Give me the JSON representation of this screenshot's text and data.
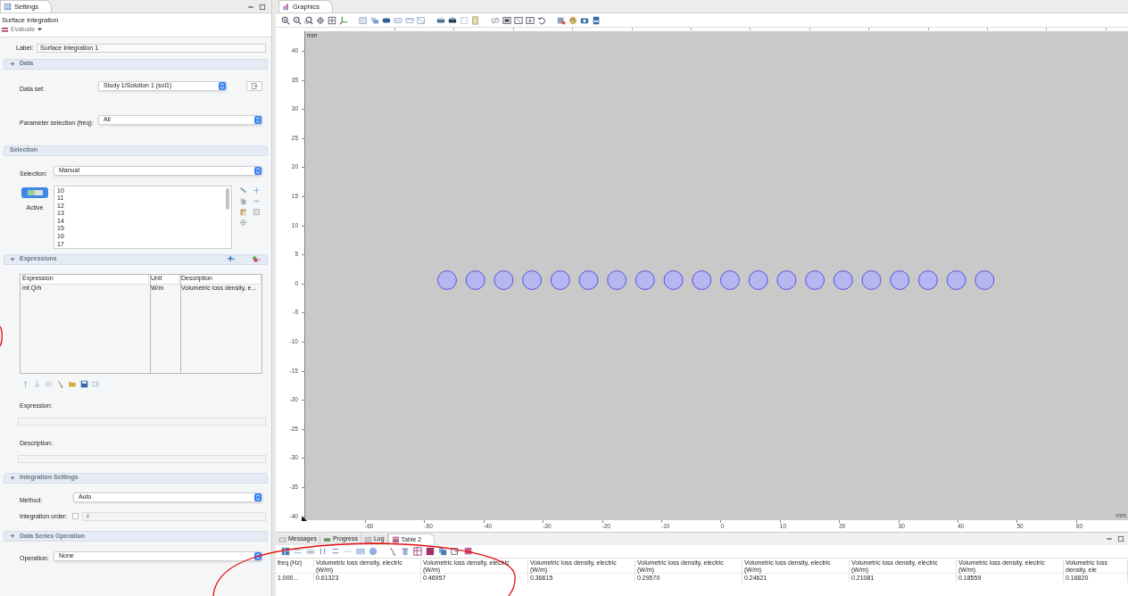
{
  "settings": {
    "tab": "Settings",
    "heading": "Surface Integration",
    "evaluate": "Evaluate",
    "label_caption": "Label:",
    "label_value": "Surface Integration 1"
  },
  "data_section": {
    "title": "Data",
    "expanded": true,
    "dataset_label": "Data set:",
    "dataset_value": "Study 1/Solution 1 (sol1)",
    "param_label": "Parameter selection (freq):",
    "param_value": "All"
  },
  "selection_section": {
    "title": "Selection",
    "selection_label": "Selection:",
    "selection_value": "Manual",
    "active": true,
    "active_label": "Active",
    "items": [
      "10",
      "11",
      "12",
      "13",
      "14",
      "15",
      "16",
      "17"
    ]
  },
  "expressions_section": {
    "title": "Expressions",
    "expanded": true,
    "columns": [
      "Expression",
      "Unit",
      "Description"
    ],
    "rows": [
      [
        "mf.Qrh",
        "W/m",
        "Volumetric loss density, e..."
      ]
    ],
    "expression_label": "Expression:",
    "description_label": "Description:"
  },
  "integration_section": {
    "title": "Integration Settings",
    "expanded": true,
    "method_label": "Method:",
    "method_value": "Auto",
    "order_label": "Integration order:",
    "order_checked": false,
    "order_value": "4"
  },
  "data_series_section": {
    "title": "Data Series Operation",
    "expanded": true,
    "operation_label": "Operation:",
    "operation_value": "None"
  },
  "graphics": {
    "tab": "Graphics",
    "unit": "mm",
    "unit_corner": "mm",
    "y_ticks": [
      "40",
      "35",
      "30",
      "25",
      "20",
      "15",
      "10",
      "5",
      "0",
      "-5",
      "-10",
      "-15",
      "-20",
      "-25",
      "-30",
      "-35",
      "-40"
    ],
    "x_ticks": [
      "-60",
      "-50",
      "-40",
      "-30",
      "-20",
      "-10",
      "0",
      "10",
      "20",
      "30",
      "40",
      "50",
      "60"
    ]
  },
  "bottom_tabs": [
    {
      "label": "Messages",
      "selected": false
    },
    {
      "label": "Progress",
      "selected": false
    },
    {
      "label": "Log",
      "selected": false
    },
    {
      "label": "Table 2",
      "selected": true
    }
  ],
  "table": {
    "columns": [
      "freq (Hz)",
      "Volumetric loss density, electric (W/m)",
      "Volumetric loss density, electric (W/m)",
      "Volumetric loss density, electric (W/m)",
      "Volumetric loss density, electric (W/m)",
      "Volumetric loss density, electric (W/m)",
      "Volumetric loss density, electric (W/m)",
      "Volumetric loss density, electric (W/m)",
      "Volumetric loss density, ele"
    ],
    "rows": [
      [
        "1.000...",
        "0.61323",
        "0.46957",
        "0.36615",
        "0.29570",
        "0.24621",
        "0.21081",
        "0.18559",
        "0.16820"
      ]
    ]
  }
}
